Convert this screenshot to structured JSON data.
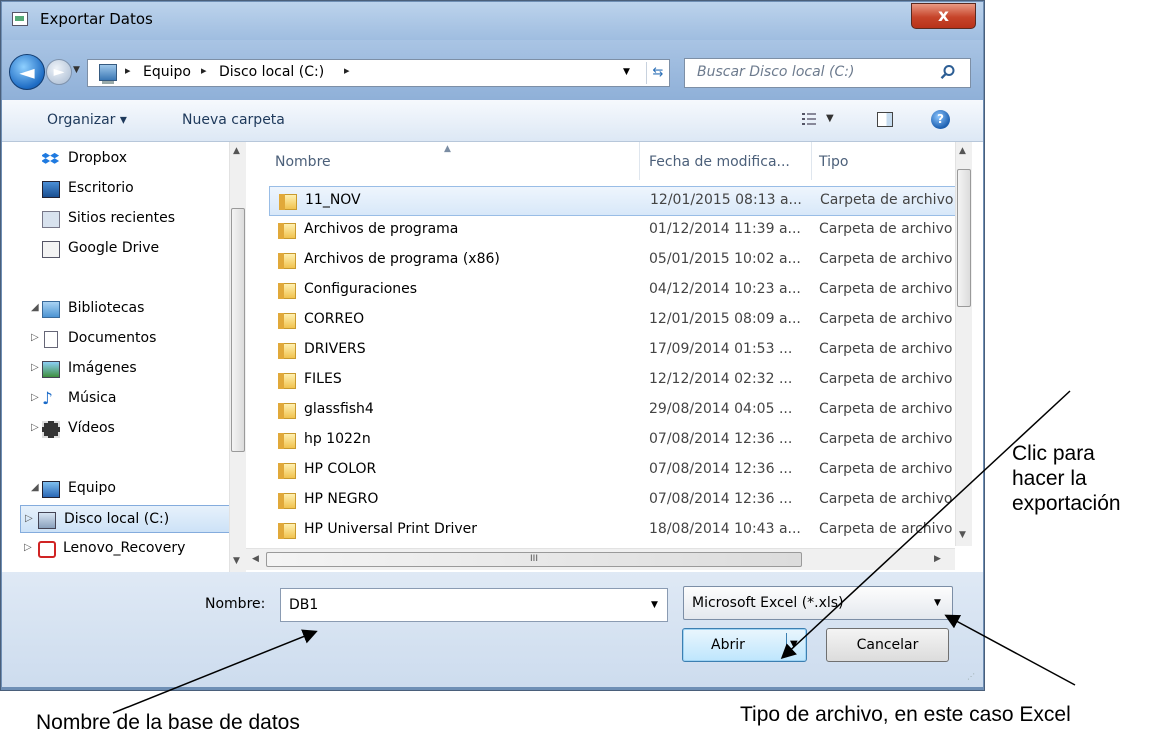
{
  "window": {
    "title": "Exportar Datos",
    "close_label": "x"
  },
  "nav": {
    "back_label": "◄",
    "forward_label": "►",
    "breadcrumb": [
      "Equipo",
      "Disco local (C:)"
    ],
    "separator": "▸",
    "search_placeholder": "Buscar Disco local (C:)"
  },
  "toolbar": {
    "organize_label": "Organizar ▾",
    "new_folder_label": "Nueva carpeta",
    "help_label": "?"
  },
  "sidebar": {
    "items": [
      {
        "label": "Dropbox",
        "icon": "dropbox-icon",
        "expander": ""
      },
      {
        "label": "Escritorio",
        "icon": "desktop-icon",
        "expander": ""
      },
      {
        "label": "Sitios recientes",
        "icon": "recent-places-icon",
        "expander": ""
      },
      {
        "label": "Google Drive",
        "icon": "google-drive-icon",
        "expander": ""
      },
      {
        "label": "Bibliotecas",
        "icon": "libraries-icon",
        "expander": "◢"
      },
      {
        "label": "Documentos",
        "icon": "documents-icon",
        "expander": "▷"
      },
      {
        "label": "Imágenes",
        "icon": "pictures-icon",
        "expander": "▷"
      },
      {
        "label": "Música",
        "icon": "music-icon",
        "expander": "▷"
      },
      {
        "label": "Vídeos",
        "icon": "videos-icon",
        "expander": "▷"
      },
      {
        "label": "Equipo",
        "icon": "computer-icon",
        "expander": "◢"
      },
      {
        "label": "Disco local (C:)",
        "icon": "local-disk-icon",
        "expander": "▷",
        "selected": true
      },
      {
        "label": "Lenovo_Recovery",
        "icon": "recovery-drive-icon",
        "expander": "▷"
      }
    ]
  },
  "files": {
    "columns": {
      "name": "Nombre",
      "date": "Fecha de modifica...",
      "type": "Tipo"
    },
    "rows": [
      {
        "name": "11_NOV",
        "date": "12/01/2015 08:13 a...",
        "type": "Carpeta de archivos",
        "selected": true
      },
      {
        "name": "Archivos de programa",
        "date": "01/12/2014 11:39 a...",
        "type": "Carpeta de archivos"
      },
      {
        "name": "Archivos de programa (x86)",
        "date": "05/01/2015 10:02 a...",
        "type": "Carpeta de archivos"
      },
      {
        "name": "Configuraciones",
        "date": "04/12/2014 10:23 a...",
        "type": "Carpeta de archivos"
      },
      {
        "name": "CORREO",
        "date": "12/01/2015 08:09 a...",
        "type": "Carpeta de archivos"
      },
      {
        "name": "DRIVERS",
        "date": "17/09/2014 01:53 ...",
        "type": "Carpeta de archivos"
      },
      {
        "name": "FILES",
        "date": "12/12/2014 02:32 ...",
        "type": "Carpeta de archivos"
      },
      {
        "name": "glassfish4",
        "date": "29/08/2014 04:05 ...",
        "type": "Carpeta de archivos"
      },
      {
        "name": "hp 1022n",
        "date": "07/08/2014 12:36 ...",
        "type": "Carpeta de archivos"
      },
      {
        "name": "HP COLOR",
        "date": "07/08/2014 12:36 ...",
        "type": "Carpeta de archivos"
      },
      {
        "name": "HP NEGRO",
        "date": "07/08/2014 12:36 ...",
        "type": "Carpeta de archivos"
      },
      {
        "name": "HP Universal Print Driver",
        "date": "18/08/2014 10:43 a...",
        "type": "Carpeta de archivos"
      }
    ],
    "hscroll_grip": "III"
  },
  "footer": {
    "name_label": "Nombre:",
    "name_value": "DB1",
    "file_type": "Microsoft Excel (*.xls)",
    "open_label": "Abrir",
    "cancel_label": "Cancelar"
  },
  "annotations": {
    "click_note": "Clic para\nhacer la\nexportación",
    "name_note": "Nombre de la base de datos",
    "type_note": "Tipo de archivo, en este caso Excel"
  }
}
